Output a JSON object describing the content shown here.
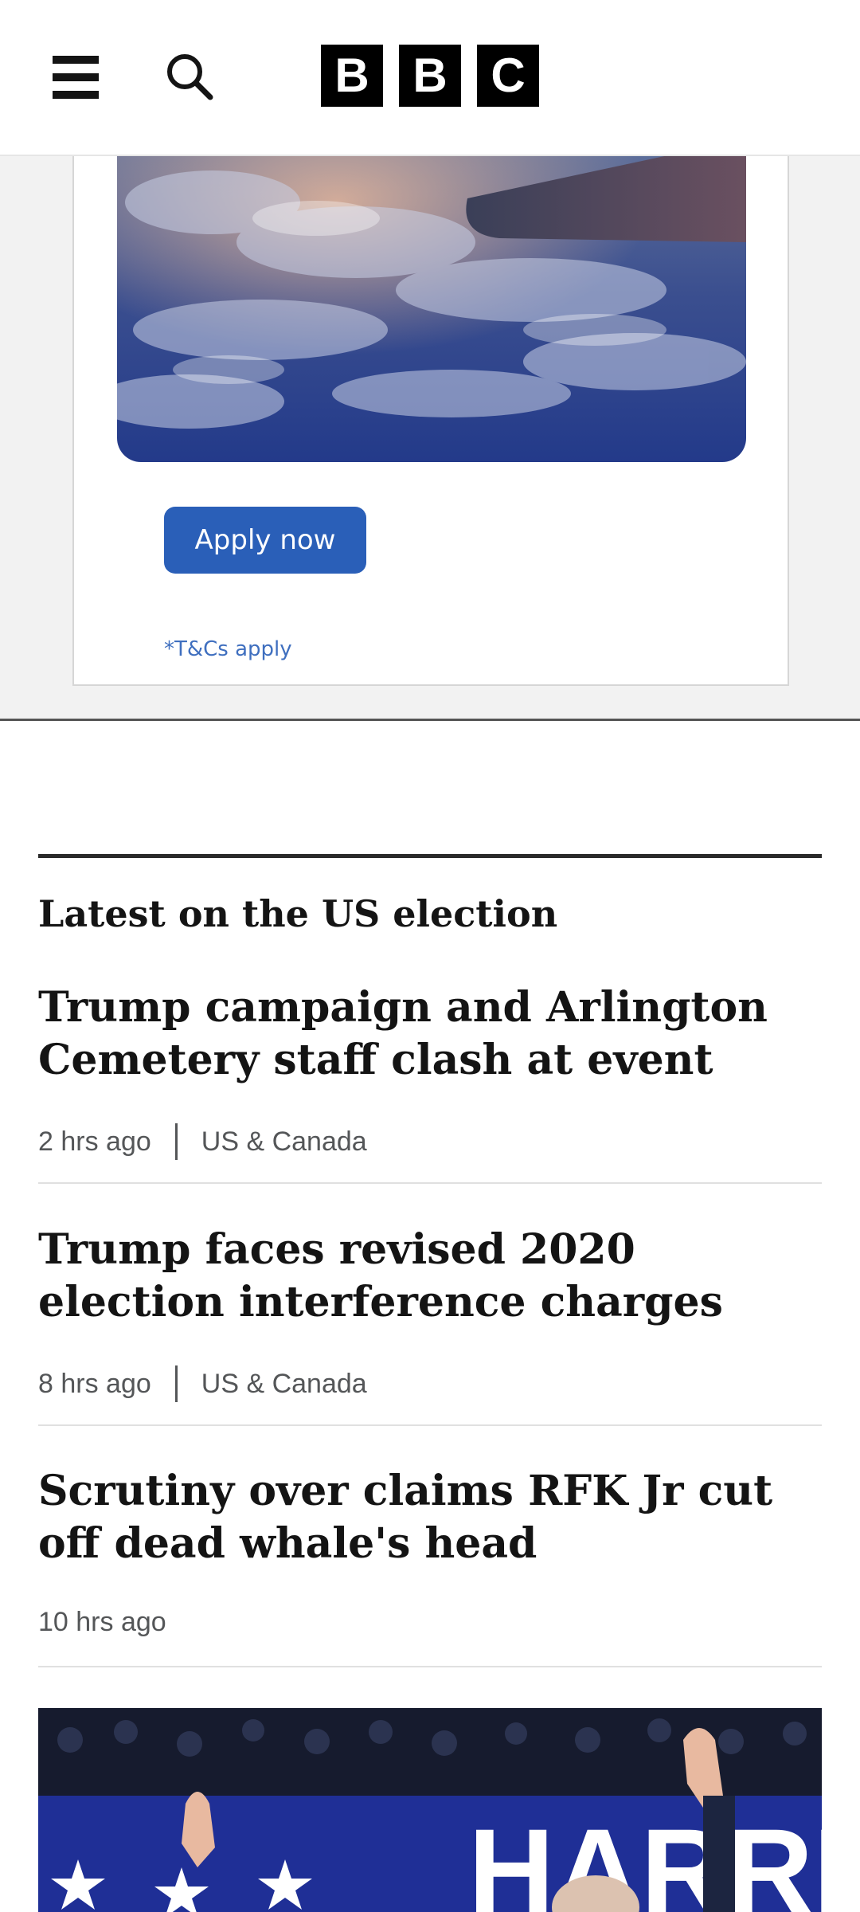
{
  "header": {
    "logo_letters": [
      "B",
      "B",
      "C"
    ],
    "icons": {
      "menu": "menu-icon",
      "search": "search-icon"
    }
  },
  "ad": {
    "cta_label": "Apply now",
    "terms": "*T&Cs apply",
    "colors": {
      "button": "#2a5fb8",
      "terms_text": "#3f6fbf"
    }
  },
  "section": {
    "title": "Latest on the US election",
    "stories": [
      {
        "headline": "Trump campaign and Arlington Cemetery staff clash at event",
        "time": "2 hrs ago",
        "category": "US & Canada"
      },
      {
        "headline": "Trump faces revised 2020 election interference charges",
        "time": "8 hrs ago",
        "category": "US & Canada"
      },
      {
        "headline": "Scrutiny over claims RFK Jr cut off dead whale's head",
        "time": "10 hrs ago",
        "category": ""
      }
    ]
  },
  "lead_image": {
    "sign_text": "HARRIS"
  }
}
